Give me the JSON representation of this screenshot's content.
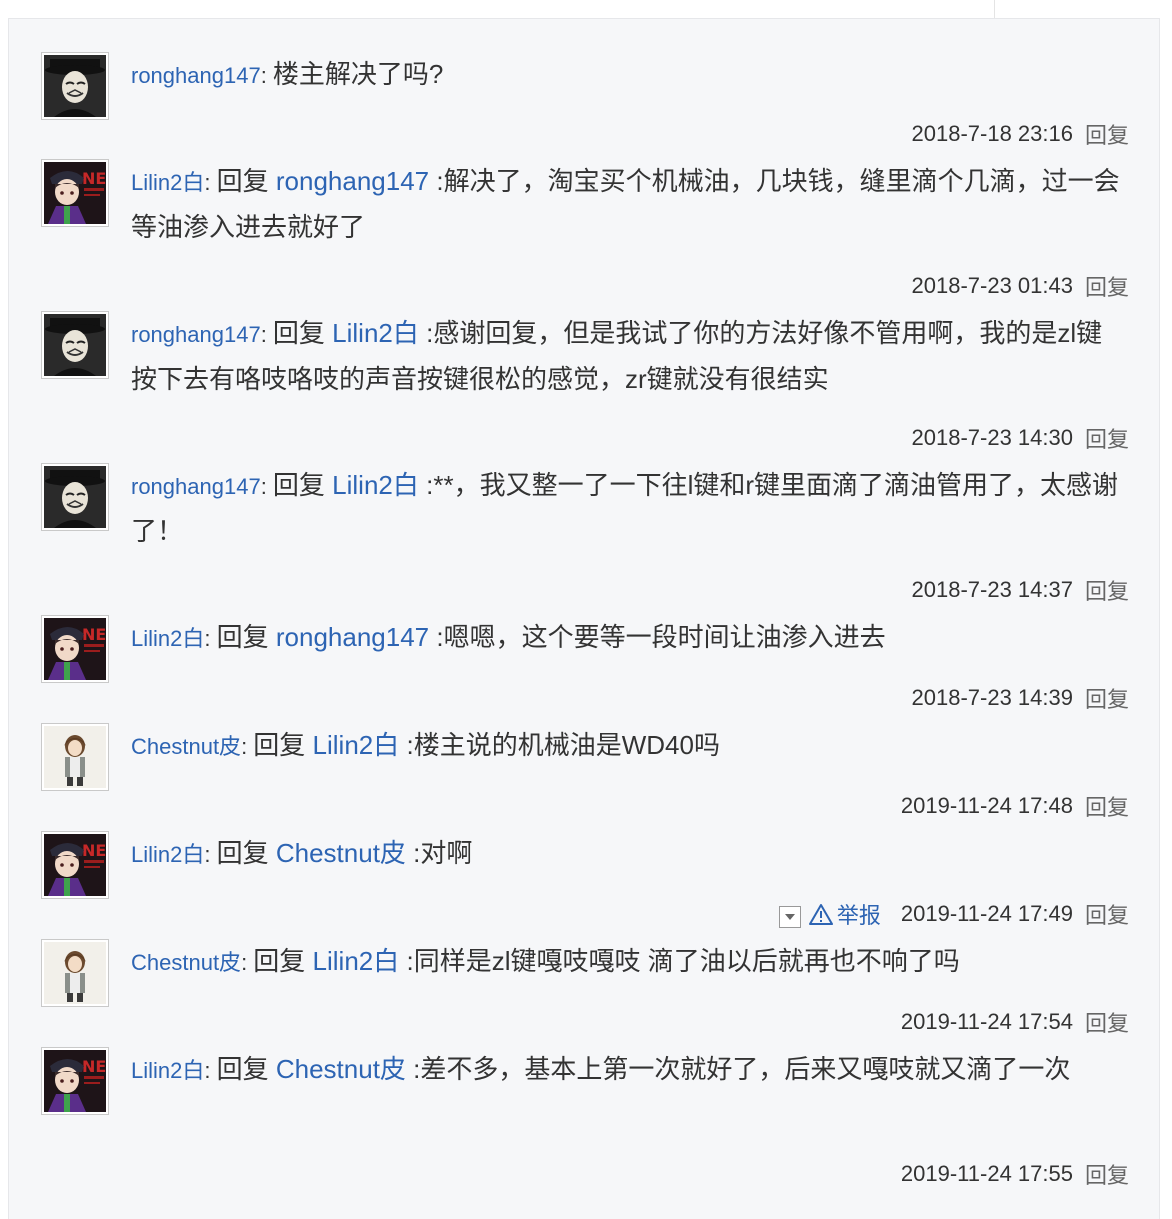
{
  "reply_label": "回复",
  "report_label": "举报",
  "comments": [
    {
      "user": "ronghang147",
      "avatar": "mask",
      "prefix": "",
      "target": "",
      "text": "楼主解决了吗?",
      "time": "2018-7-18 23:16"
    },
    {
      "user": "Lilin2白",
      "avatar": "anime",
      "prefix": "回复",
      "target": "ronghang147",
      "text": ":解决了，淘宝买个机械油，几块钱，缝里滴个几滴，过一会等油渗入进去就好了",
      "time": "2018-7-23 01:43"
    },
    {
      "user": "ronghang147",
      "avatar": "mask",
      "prefix": "回复",
      "target": "Lilin2白",
      "text": ":感谢回复，但是我试了你的方法好像不管用啊，我的是zl键按下去有咯吱咯吱的声音按键很松的感觉，zr键就没有很结实",
      "time": "2018-7-23 14:30"
    },
    {
      "user": "ronghang147",
      "avatar": "mask",
      "prefix": "回复",
      "target": "Lilin2白",
      "text": ":**，我又整一了一下往l键和r键里面滴了滴油管用了，太感谢了！",
      "time": "2018-7-23 14:37"
    },
    {
      "user": "Lilin2白",
      "avatar": "anime",
      "prefix": "回复",
      "target": "ronghang147",
      "text": ":嗯嗯，这个要等一段时间让油渗入进去",
      "time": "2018-7-23 14:39"
    },
    {
      "user": "Chestnut皮",
      "avatar": "girl",
      "prefix": "回复",
      "target": "Lilin2白",
      "text": ":楼主说的机械油是WD40吗",
      "time": "2019-11-24 17:48"
    },
    {
      "user": "Lilin2白",
      "avatar": "anime",
      "prefix": "回复",
      "target": "Chestnut皮",
      "text": ":对啊",
      "time": "2019-11-24 17:49",
      "report": true
    },
    {
      "user": "Chestnut皮",
      "avatar": "girl",
      "prefix": "回复",
      "target": "Lilin2白",
      "text": ":同样是zl键嘎吱嘎吱 滴了油以后就再也不响了吗",
      "time": "2019-11-24 17:54"
    },
    {
      "user": "Lilin2白",
      "avatar": "anime",
      "prefix": "回复",
      "target": "Chestnut皮",
      "text": ":差不多，基本上第一次就好了，后来又嘎吱就又滴了一次",
      "time": "2019-11-24 17:55"
    }
  ]
}
